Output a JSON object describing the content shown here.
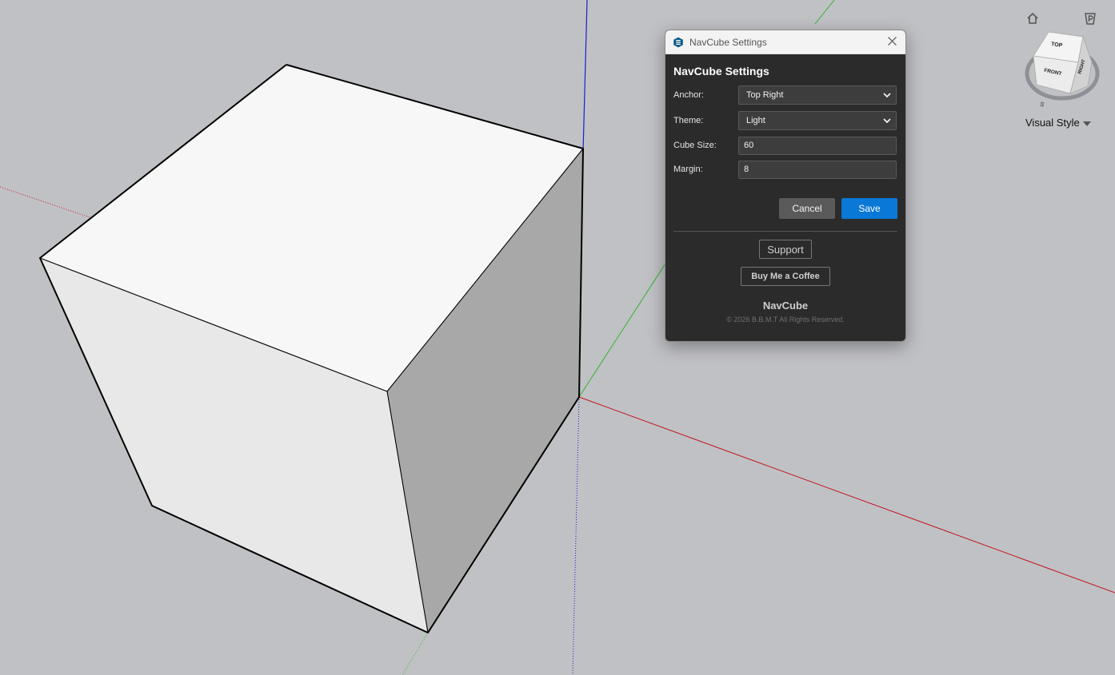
{
  "dialog": {
    "window_title": "NavCube Settings",
    "heading": "NavCube Settings",
    "fields": {
      "anchor": {
        "label": "Anchor:",
        "value": "Top Right"
      },
      "theme": {
        "label": "Theme:",
        "value": "Light"
      },
      "cube_size": {
        "label": "Cube Size:",
        "value": "60"
      },
      "margin": {
        "label": "Margin:",
        "value": "8"
      }
    },
    "buttons": {
      "cancel": "Cancel",
      "save": "Save"
    },
    "support": "Support",
    "coffee": "Buy Me a Coffee",
    "footer_title": "NavCube",
    "footer_copy": "© 2026 B.B.M.T All Rights Reserved.",
    "accent_color": "#0a78d6"
  },
  "navcube": {
    "faces": {
      "top": "TOP",
      "front": "FRONT",
      "right": "RIGHT"
    },
    "compass_s": "S",
    "visual_style": "Visual Style",
    "icons": [
      "home-icon",
      "perspective-icon",
      "chevron-down-icon"
    ]
  },
  "scene": {
    "background": "#c0c1c5",
    "axis_colors": {
      "red": "#c0161c",
      "green": "#2db52b",
      "blue": "#1a1fcc"
    }
  }
}
